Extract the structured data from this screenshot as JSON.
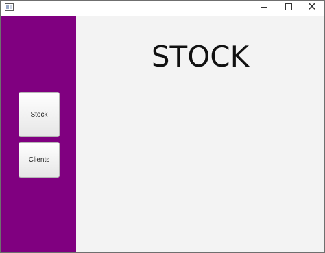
{
  "colors": {
    "sidebar": "#800080",
    "content_background": "#f3f3f3",
    "titlebar": "#ffffff",
    "button_gradient_top": "#ffffff",
    "button_gradient_bottom": "#e6e6e6"
  },
  "titlebar": {
    "app_icon": "window-icon",
    "controls": {
      "minimize": "minimize-icon",
      "maximize": "maximize-icon",
      "close": "close-icon",
      "close_glyph": "✕"
    }
  },
  "sidebar": {
    "buttons": [
      {
        "label": "Stock"
      },
      {
        "label": "Clients"
      }
    ]
  },
  "main": {
    "title": "STOCK"
  }
}
